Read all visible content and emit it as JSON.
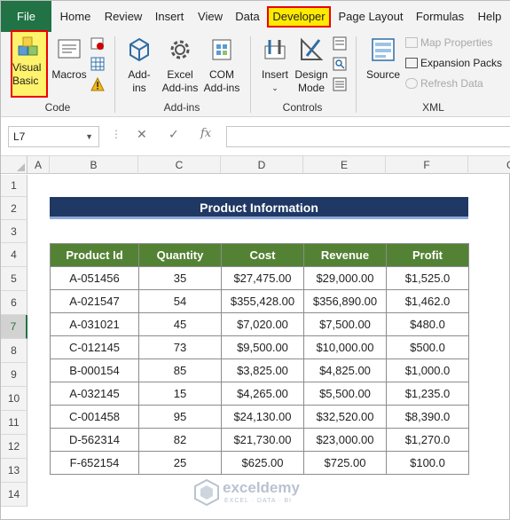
{
  "ribbon_tabs": {
    "file": "File",
    "home": "Home",
    "review": "Review",
    "insert": "Insert",
    "view": "View",
    "data": "Data",
    "developer": "Developer",
    "page_layout": "Page Layout",
    "formulas": "Formulas",
    "help": "Help"
  },
  "code_group": {
    "visual_basic_line1": "Visual",
    "visual_basic_line2": "Basic",
    "macros": "Macros",
    "label": "Code"
  },
  "addins_group": {
    "addins_line1": "Add-",
    "addins_line2": "ins",
    "excel_addins_line1": "Excel",
    "excel_addins_line2": "Add-ins",
    "com_addins_line1": "COM",
    "com_addins_line2": "Add-ins",
    "label": "Add-ins"
  },
  "controls_group": {
    "insert": "Insert",
    "design_mode_line1": "Design",
    "design_mode_line2": "Mode",
    "label": "Controls"
  },
  "xml_group": {
    "source": "Source",
    "map_properties": "Map Properties",
    "expansion_packs": "Expansion Packs",
    "refresh_data": "Refresh Data",
    "label": "XML"
  },
  "formula_bar": {
    "name_box": "L7",
    "cancel": "✕",
    "enter": "✓",
    "fx": "fx",
    "content": ""
  },
  "columns": [
    "A",
    "B",
    "C",
    "D",
    "E",
    "F",
    "G"
  ],
  "rows": [
    "1",
    "2",
    "3",
    "4",
    "5",
    "6",
    "7",
    "8",
    "9",
    "10",
    "11",
    "12",
    "13",
    "14"
  ],
  "selected_row": "7",
  "sheet": {
    "title": "Product Information",
    "headers": [
      "Product Id",
      "Quantity",
      "Cost",
      "Revenue",
      "Profit"
    ],
    "records": [
      [
        "A-051456",
        "35",
        "$27,475.00",
        "$29,000.00",
        "$1,525.0"
      ],
      [
        "A-021547",
        "54",
        "$355,428.00",
        "$356,890.00",
        "$1,462.0"
      ],
      [
        "A-031021",
        "45",
        "$7,020.00",
        "$7,500.00",
        "$480.0"
      ],
      [
        "C-012145",
        "73",
        "$9,500.00",
        "$10,000.00",
        "$500.0"
      ],
      [
        "B-000154",
        "85",
        "$3,825.00",
        "$4,825.00",
        "$1,000.0"
      ],
      [
        "A-032145",
        "15",
        "$4,265.00",
        "$5,500.00",
        "$1,235.0"
      ],
      [
        "C-001458",
        "95",
        "$24,130.00",
        "$32,520.00",
        "$8,390.0"
      ],
      [
        "D-562314",
        "82",
        "$21,730.00",
        "$23,000.00",
        "$1,270.0"
      ],
      [
        "F-652154",
        "25",
        "$625.00",
        "$725.00",
        "$100.0"
      ]
    ]
  },
  "watermark": {
    "name": "exceldemy",
    "tagline": "EXCEL · DATA · BI"
  },
  "colors": {
    "excel_green": "#217346",
    "header_green": "#548235",
    "title_navy": "#1f3864",
    "highlight_yellow": "#ffeb00",
    "highlight_red": "#e00000"
  }
}
